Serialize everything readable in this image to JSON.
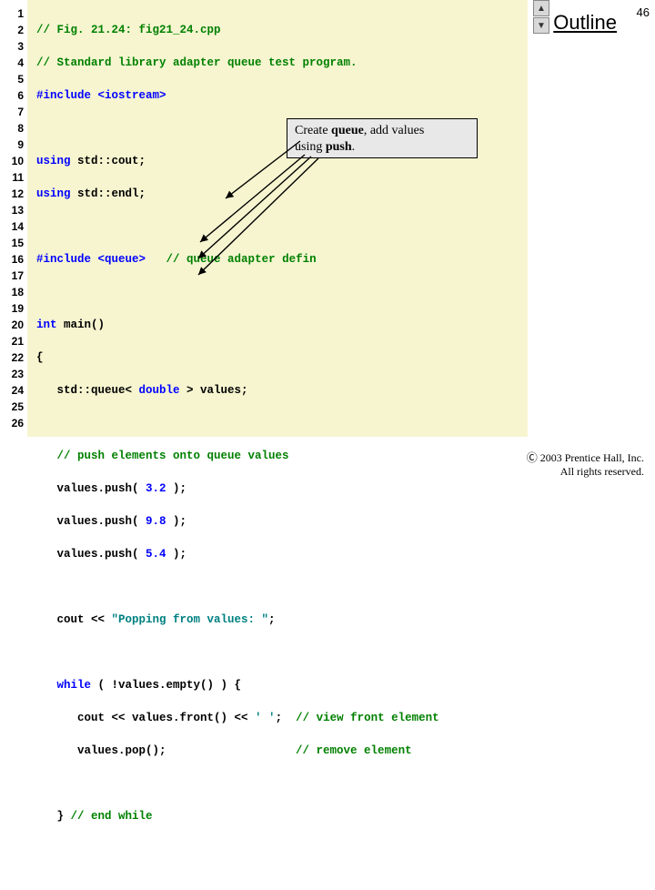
{
  "slide_number": "46",
  "outline_label": "Outline",
  "gutter": [
    "1",
    "2",
    "3",
    "4",
    "5",
    "6",
    "7",
    "8",
    "9",
    "10",
    "11",
    "12",
    "13",
    "14",
    "15",
    "16",
    "17",
    "18",
    "19",
    "20",
    "21",
    "22",
    "23",
    "24",
    "25",
    "26"
  ],
  "code": {
    "l1_a": "// Fig. 21.24: fig21_24.cpp",
    "l2_a": "// Standard library adapter queue test program.",
    "l3_a": "#include ",
    "l3_b": "<iostream>",
    "l5_a": "using ",
    "l5_b": "std::cout;",
    "l6_a": "using ",
    "l6_b": "std::endl;",
    "l8_a": "#include ",
    "l8_b": "<queue>",
    "l8_c": "   ",
    "l8_d": "// queue adapter defin",
    "l10_a": "int",
    "l10_b": " main()",
    "l11_a": "{",
    "l12_a": "   std::queue< ",
    "l12_b": "double",
    "l12_c": " > values;",
    "l14_a": "   ",
    "l14_b": "// push elements onto queue values",
    "l15_a": "   values.push( ",
    "l15_b": "3.2",
    "l15_c": " );",
    "l16_a": "   values.push( ",
    "l16_b": "9.8",
    "l16_c": " );",
    "l17_a": "   values.push( ",
    "l17_b": "5.4",
    "l17_c": " );",
    "l19_a": "   cout << ",
    "l19_b": "\"Popping from values: \"",
    "l19_c": ";",
    "l21_a": "   ",
    "l21_b": "while",
    "l21_c": " ( !values.empty() ) {",
    "l22_a": "      cout << values.front() << ",
    "l22_b": "' '",
    "l22_c": ";  ",
    "l22_d": "// view front element",
    "l23_a": "      values.pop();                   ",
    "l23_b": "// remove element",
    "l25_a": "   } ",
    "l25_b": "// end while"
  },
  "callout": {
    "line1_a": "Create ",
    "line1_b": "queue",
    "line1_c": ", add values",
    "line2_a": "using ",
    "line2_b": "push",
    "line2_c": "."
  },
  "scroll": {
    "up": "▲",
    "down": "▼"
  },
  "copyright": {
    "line1": "Ⓒ 2003 Prentice Hall, Inc.",
    "line2": "All rights reserved."
  }
}
